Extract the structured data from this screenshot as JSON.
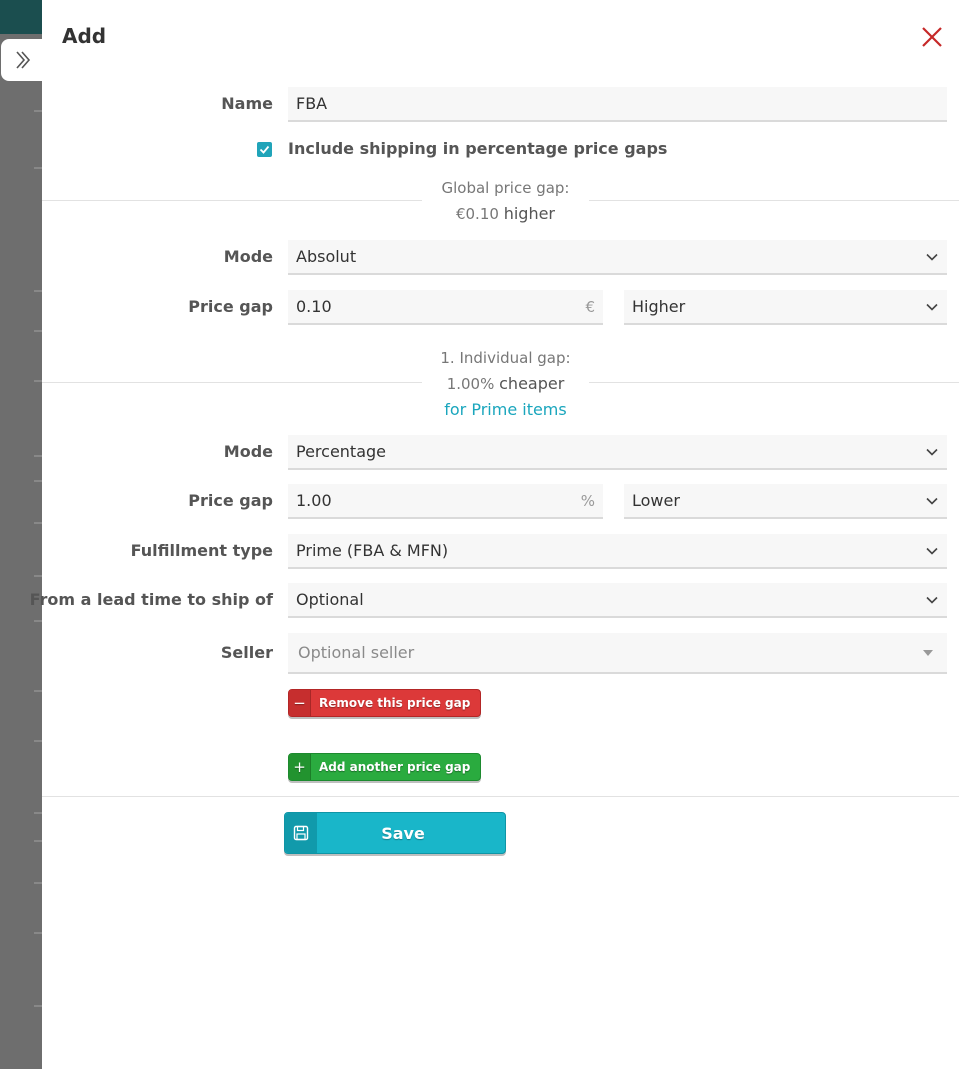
{
  "dialog": {
    "title": "Add",
    "name_label": "Name",
    "name_value": "FBA",
    "include_shipping_label": "Include shipping in percentage price gaps",
    "include_shipping_checked": true
  },
  "global_gap": {
    "heading": "Global price gap:",
    "value": "€0.10",
    "direction": "higher",
    "mode_label": "Mode",
    "mode_value": "Absolut",
    "price_gap_label": "Price gap",
    "price_gap_value": "0.10",
    "price_gap_unit": "€",
    "direction_value": "Higher"
  },
  "individual_gap": {
    "heading": "1. Individual gap:",
    "value": "1.00%",
    "direction": "cheaper",
    "condition": "for Prime items",
    "mode_label": "Mode",
    "mode_value": "Percentage",
    "price_gap_label": "Price gap",
    "price_gap_value": "1.00",
    "price_gap_unit": "%",
    "direction_value": "Lower",
    "fulfillment_label": "Fulfillment type",
    "fulfillment_value": "Prime (FBA & MFN)",
    "lead_time_label": "From a lead time to ship of",
    "lead_time_value": "Optional",
    "seller_label": "Seller",
    "seller_placeholder": "Optional seller",
    "remove_button": "Remove this price gap"
  },
  "actions": {
    "add_button": "Add another price gap",
    "save_button": "Save"
  },
  "colors": {
    "accent": "#19b6c9",
    "danger": "#dc3939",
    "success": "#2aab3f",
    "close": "#c62828"
  },
  "icons": [
    "chevron-right-icon",
    "close-icon",
    "chevron-down-icon",
    "check-icon",
    "minus-icon",
    "plus-icon",
    "floppy-disk-icon"
  ]
}
